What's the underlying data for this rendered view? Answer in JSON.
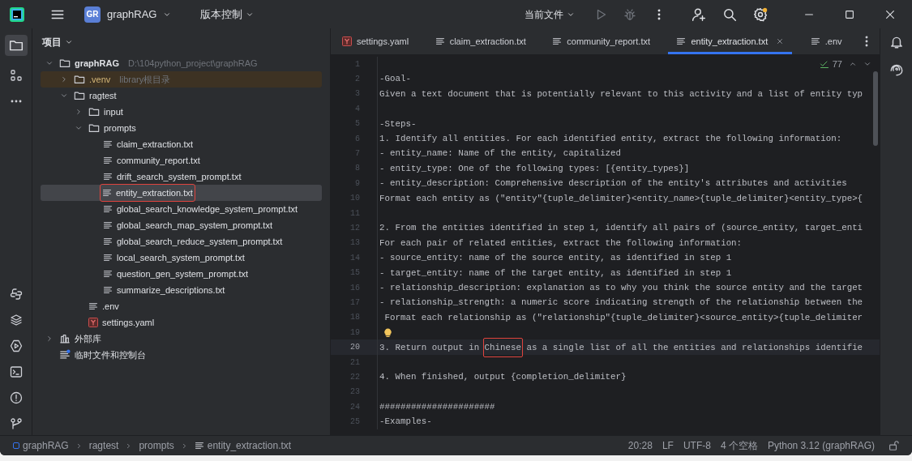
{
  "title_bar": {
    "project": {
      "badge": "GR",
      "name": "graphRAG"
    },
    "vcs": "版本控制",
    "run_config": "当前文件",
    "settings_notice": true
  },
  "project_panel": {
    "title": "项目",
    "tree": [
      {
        "kind": "folder",
        "label": "graphRAG",
        "note": "D:\\104python_project\\graphRAG",
        "expanded": true,
        "bold": true,
        "children": [
          {
            "kind": "folder",
            "label": ".venv",
            "note": "library根目录",
            "expanded": false,
            "excluded": true
          },
          {
            "kind": "folder",
            "label": "ragtest",
            "expanded": true,
            "children": [
              {
                "kind": "folder",
                "label": "input",
                "expanded": false
              },
              {
                "kind": "folder",
                "label": "prompts",
                "expanded": true,
                "children": [
                  {
                    "kind": "text",
                    "label": "claim_extraction.txt",
                    "selected": false
                  },
                  {
                    "kind": "text",
                    "label": "community_report.txt",
                    "selected": false
                  },
                  {
                    "kind": "text",
                    "label": "drift_search_system_prompt.txt",
                    "selected": false
                  },
                  {
                    "kind": "text",
                    "label": "entity_extraction.txt",
                    "selected": true,
                    "boxed": true
                  },
                  {
                    "kind": "text",
                    "label": "global_search_knowledge_system_prompt.txt",
                    "selected": false
                  },
                  {
                    "kind": "text",
                    "label": "global_search_map_system_prompt.txt",
                    "selected": false
                  },
                  {
                    "kind": "text",
                    "label": "global_search_reduce_system_prompt.txt",
                    "selected": false
                  },
                  {
                    "kind": "text",
                    "label": "local_search_system_prompt.txt",
                    "selected": false
                  },
                  {
                    "kind": "text",
                    "label": "question_gen_system_prompt.txt",
                    "selected": false
                  },
                  {
                    "kind": "text",
                    "label": "summarize_descriptions.txt",
                    "selected": false
                  }
                ]
              },
              {
                "kind": "text",
                "label": ".env",
                "selected": false
              },
              {
                "kind": "yaml",
                "label": "settings.yaml",
                "selected": false
              }
            ]
          }
        ]
      },
      {
        "kind": "library",
        "label": "外部库",
        "expanded": false
      },
      {
        "kind": "scratch",
        "label": "临时文件和控制台"
      }
    ]
  },
  "tabs": [
    {
      "kind": "yaml",
      "label": "settings.yaml",
      "selected": false
    },
    {
      "kind": "text",
      "label": "claim_extraction.txt",
      "selected": false
    },
    {
      "kind": "text",
      "label": "community_report.txt",
      "selected": false
    },
    {
      "kind": "text",
      "label": "entity_extraction.txt",
      "selected": true
    },
    {
      "kind": "text",
      "label": ".env",
      "selected": false
    }
  ],
  "editor": {
    "inspection_count": "77",
    "lines": [
      {
        "number": "1"
      },
      {
        "number": "2",
        "text": "-Goal-"
      },
      {
        "number": "3",
        "text": "Given a text document that is potentially relevant to this activity and a list of entity typ"
      },
      {
        "number": "4"
      },
      {
        "number": "5",
        "text": "-Steps-"
      },
      {
        "number": "6",
        "text": "1. Identify all entities. For each identified entity, extract the following information:"
      },
      {
        "number": "7",
        "text": "- entity_name: Name of the entity, capitalized"
      },
      {
        "number": "8",
        "text": "- entity_type: One of the following types: [{entity_types}]"
      },
      {
        "number": "9",
        "text": "- entity_description: Comprehensive description of the entity's attributes and activities"
      },
      {
        "number": "10",
        "text": "Format each entity as (\"entity\"{tuple_delimiter}<entity_name>{tuple_delimiter}<entity_type>{"
      },
      {
        "number": "11"
      },
      {
        "number": "12",
        "text": "2. From the entities identified in step 1, identify all pairs of (source_entity, target_enti"
      },
      {
        "number": "13",
        "text": "For each pair of related entities, extract the following information:"
      },
      {
        "number": "14",
        "text": "- source_entity: name of the source entity, as identified in step 1"
      },
      {
        "number": "15",
        "text": "- target_entity: name of the target entity, as identified in step 1"
      },
      {
        "number": "16",
        "text": "- relationship_description: explanation as to why you think the source entity and the target"
      },
      {
        "number": "17",
        "text": "- relationship_strength: a numeric score indicating strength of the relationship between the"
      },
      {
        "number": "18",
        "text": " Format each relationship as (\"relationship\"{tuple_delimiter}<source_entity>{tuple_delimiter"
      },
      {
        "number": "19",
        "bulb": true
      },
      {
        "number": "20",
        "current": true,
        "parts": [
          {
            "text": "3. Return output in "
          },
          {
            "text": "Chinese",
            "boxed": true
          },
          {
            "text": " as a single list of all the entities and relationships identifie"
          }
        ]
      },
      {
        "number": "21"
      },
      {
        "number": "22",
        "text": "4. When finished, output {completion_delimiter}"
      },
      {
        "number": "23"
      },
      {
        "number": "24",
        "text": "######################"
      },
      {
        "number": "25",
        "text": "-Examples-"
      }
    ]
  },
  "breadcrumbs": [
    "graphRAG",
    "ragtest",
    "prompts",
    "entity_extraction.txt"
  ],
  "status_bar": [
    "20:28",
    "LF",
    "UTF-8",
    "4 个空格",
    "Python 3.12 (graphRAG)"
  ]
}
